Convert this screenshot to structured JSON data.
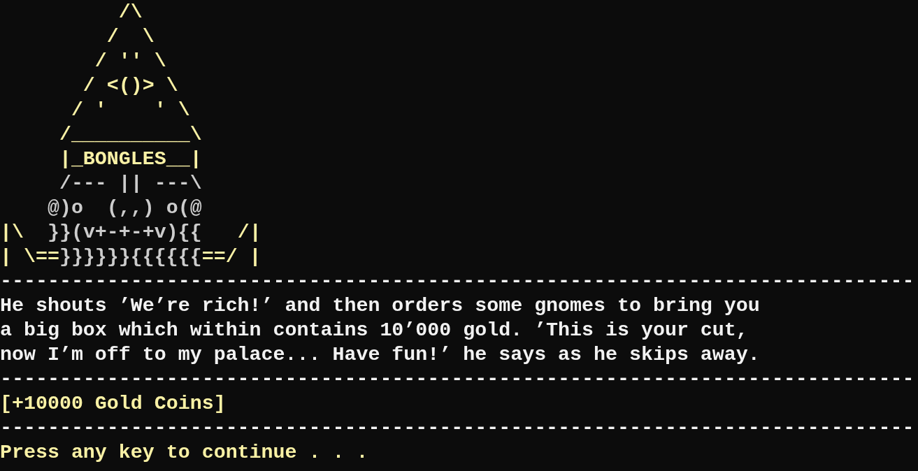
{
  "art_lines": [
    {
      "segments": [
        {
          "text": "          /\\",
          "kind": "gold"
        }
      ]
    },
    {
      "segments": [
        {
          "text": "         /  \\",
          "kind": "gold"
        }
      ]
    },
    {
      "segments": [
        {
          "text": "        / '' \\",
          "kind": "gold"
        }
      ]
    },
    {
      "segments": [
        {
          "text": "       / <()> \\",
          "kind": "gold"
        }
      ]
    },
    {
      "segments": [
        {
          "text": "      / '    ' \\",
          "kind": "gold"
        }
      ]
    },
    {
      "segments": [
        {
          "text": "     /__________\\",
          "kind": "gold"
        }
      ]
    },
    {
      "segments": [
        {
          "text": "     |_BONGLES__|",
          "kind": "gold"
        }
      ]
    },
    {
      "segments": [
        {
          "text": "     /--- || ---\\",
          "kind": "grey"
        }
      ]
    },
    {
      "segments": [
        {
          "text": "    @)o  (,,) o(@",
          "kind": "grey"
        }
      ]
    },
    {
      "segments": [
        {
          "text": "|\\  ",
          "kind": "gold"
        },
        {
          "text": "}}(v+-+-+v){{",
          "kind": "grey"
        },
        {
          "text": "   /|",
          "kind": "gold"
        }
      ]
    },
    {
      "segments": [
        {
          "text": "| \\==",
          "kind": "gold"
        },
        {
          "text": "}}}}}}{{{{{{",
          "kind": "grey"
        },
        {
          "text": "==/ |",
          "kind": "gold"
        }
      ]
    }
  ],
  "lines": [
    {
      "kind": "divider",
      "text": "-----------------------------------------------------------------------------"
    },
    {
      "kind": "narration",
      "text": "He shouts ’We’re rich!’ and then orders some gnomes to bring you"
    },
    {
      "kind": "narration",
      "text": "a big box which within contains 10’000 gold. ’This is your cut,"
    },
    {
      "kind": "narration",
      "text": "now I’m off to my palace... Have fun!’ he says as he skips away."
    },
    {
      "kind": "divider",
      "text": "-----------------------------------------------------------------------------"
    },
    {
      "kind": "reward",
      "text": "[+10000 Gold Coins]"
    },
    {
      "kind": "divider",
      "text": "-----------------------------------------------------------------------------"
    },
    {
      "kind": "prompt",
      "text": "Press any key to continue . . ."
    }
  ]
}
